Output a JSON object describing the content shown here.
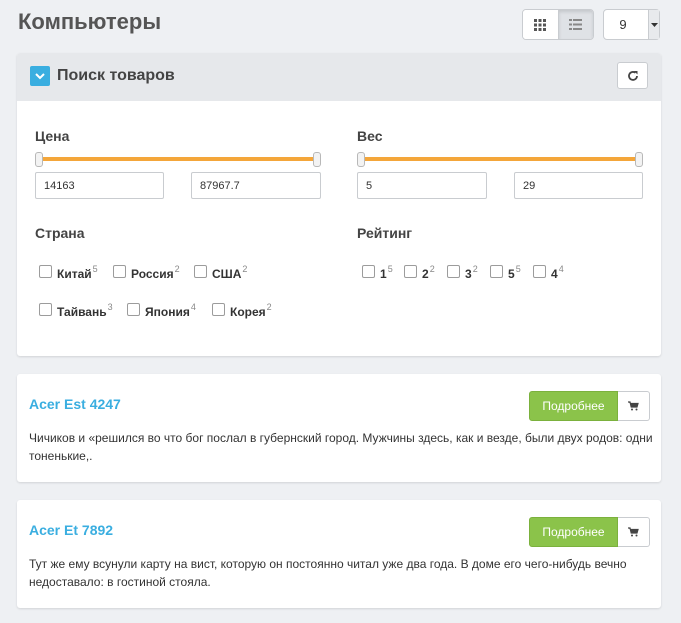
{
  "page": {
    "title": "Компьютеры"
  },
  "toolbar": {
    "per_page": "9"
  },
  "filter": {
    "title": "Поиск товаров",
    "price": {
      "label": "Цена",
      "min": "14163",
      "max": "87967.7"
    },
    "weight": {
      "label": "Вес",
      "min": "5",
      "max": "29"
    },
    "country": {
      "label": "Страна",
      "options": [
        {
          "label": "Китай",
          "count": "5"
        },
        {
          "label": "Россия",
          "count": "2"
        },
        {
          "label": "США",
          "count": "2"
        },
        {
          "label": "Тайвань",
          "count": "3"
        },
        {
          "label": "Япония",
          "count": "4"
        },
        {
          "label": "Корея",
          "count": "2"
        }
      ]
    },
    "rating": {
      "label": "Рейтинг",
      "options": [
        {
          "label": "1",
          "count": "5"
        },
        {
          "label": "2",
          "count": "2"
        },
        {
          "label": "3",
          "count": "2"
        },
        {
          "label": "5",
          "count": "5"
        },
        {
          "label": "4",
          "count": "4"
        }
      ]
    }
  },
  "products": [
    {
      "title": "Acer Est 4247",
      "details_label": "Подробнее",
      "description": "Чичиков и «решился во что бог послал в губернский город. Мужчины здесь, как и везде, были двух родов: одни тоненькие,."
    },
    {
      "title": "Acer Et 7892",
      "details_label": "Подробнее",
      "description": "Тут же ему всунули карту на вист, которую он постоянно читал уже два года. В доме его чего-нибудь вечно недоставало: в гостиной стояла."
    }
  ],
  "colors": {
    "accent": "#3aaee0",
    "slider": "#f4a63a",
    "button": "#8bc34a"
  }
}
